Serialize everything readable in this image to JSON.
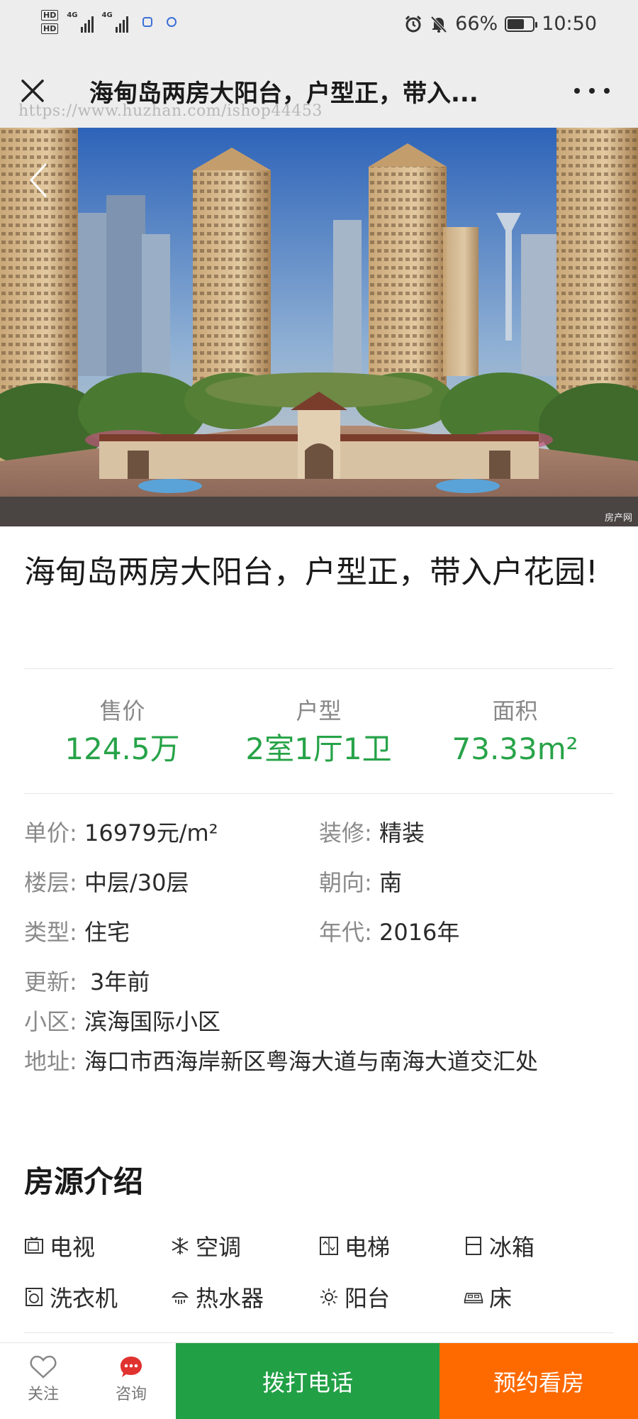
{
  "status_bar": {
    "hd1": "HD",
    "hd2": "HD",
    "net1": "4G",
    "net2": "4G",
    "battery_percent": "66%",
    "battery_level": 0.66,
    "time": "10:50"
  },
  "nav": {
    "close_icon": "close-icon",
    "title": "海甸岛两房大阳台，户型正，带入...",
    "more_icon": "more-icon",
    "watermark": "https://www.huzhan.com/ishop44453"
  },
  "hero": {
    "credit": "房产网"
  },
  "listing": {
    "title": "海甸岛两房大阳台，户型正，带入户花园!"
  },
  "stats": [
    {
      "label": "售价",
      "value": "124.5万"
    },
    {
      "label": "户型",
      "value": "2室1厅1卫"
    },
    {
      "label": "面积",
      "value": "73.33m²"
    }
  ],
  "info": {
    "unit_price_label": "单价:",
    "unit_price": "16979元/m²",
    "decoration_label": "装修:",
    "decoration": "精装",
    "floor_label": "楼层:",
    "floor": "中层/30层",
    "orientation_label": "朝向:",
    "orientation": "南",
    "type_label": "类型:",
    "type": "住宅",
    "year_label": "年代:",
    "year": "2016年",
    "updated_label": "更新:",
    "updated": "3年前",
    "community_label": "小区:",
    "community": "滨海国际小区",
    "address_label": "地址:",
    "address": "海口市西海岸新区粤海大道与南海大道交汇处"
  },
  "section": {
    "title": "房源介绍"
  },
  "amenities": [
    {
      "label": "电视",
      "icon": "tv-icon"
    },
    {
      "label": "空调",
      "icon": "snowflake-icon"
    },
    {
      "label": "电梯",
      "icon": "elevator-icon"
    },
    {
      "label": "冰箱",
      "icon": "fridge-icon"
    },
    {
      "label": "洗衣机",
      "icon": "washer-icon"
    },
    {
      "label": "热水器",
      "icon": "shower-icon"
    },
    {
      "label": "阳台",
      "icon": "sun-icon"
    },
    {
      "label": "床",
      "icon": "bed-icon"
    }
  ],
  "bottom": {
    "follow": "关注",
    "consult": "咨询",
    "call": "拨打电话",
    "book": "预约看房"
  },
  "colors": {
    "accent_green": "#27a348",
    "call_green": "#22a046",
    "book_orange": "#ff6a00"
  }
}
